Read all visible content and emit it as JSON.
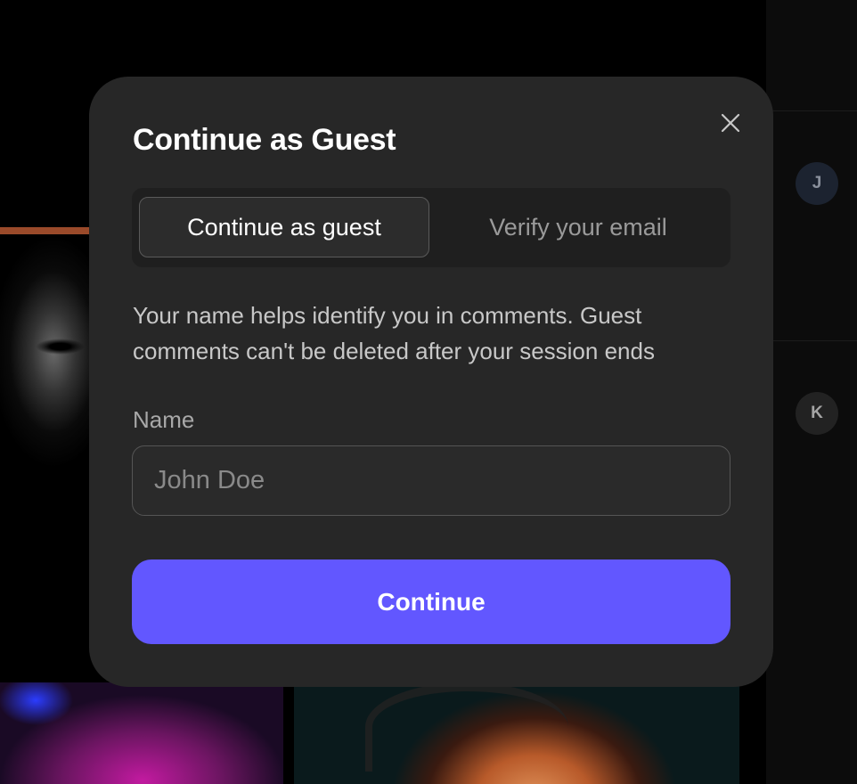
{
  "modal": {
    "title": "Continue as Guest",
    "tabs": [
      {
        "label": "Continue as guest",
        "active": true
      },
      {
        "label": "Verify your email",
        "active": false
      }
    ],
    "description": "Your name helps identify you in comments. Guest comments can't be deleted after your session ends",
    "name_field": {
      "label": "Name",
      "placeholder": "John Doe",
      "value": ""
    },
    "continue_label": "Continue",
    "close_icon": "close-icon"
  },
  "side_panel": {
    "avatars": [
      {
        "initial": "J"
      },
      {
        "initial": "K"
      }
    ]
  },
  "colors": {
    "modal_bg": "#272727",
    "accent": "#6257ff",
    "page_bg": "#000000"
  }
}
